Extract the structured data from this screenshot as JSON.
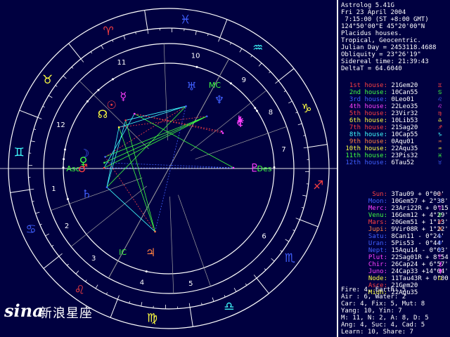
{
  "header": {
    "program": "Astrolog 5.41G",
    "date": "Fri 23 April 2004",
    "time": " 7:15:00 (ST +8:00 GMT)",
    "location": "124°50'00\"E 45°20'00\"N",
    "house_system": "Placidus houses.",
    "zodiac": "Tropical, Geocentric.",
    "julian_day": "Julian Day = 2453118.4688",
    "obliquity": "Obliquity = 23°26'19\"",
    "sidereal": "Sidereal time: 21:39:43",
    "delta_t": "DeltaT = 64.6040"
  },
  "houses": [
    {
      "label": "1st house:",
      "value": "21Gem20",
      "color": "#ff4040",
      "glyph": "♊"
    },
    {
      "label": "2nd house:",
      "value": "10Can55",
      "color": "#40ff40",
      "glyph": "♋"
    },
    {
      "label": "3rd house:",
      "value": "0Leo01",
      "color": "#4060ff",
      "glyph": "♌"
    },
    {
      "label": "4th house:",
      "value": "22Leo35",
      "color": "#ff40ff",
      "glyph": "♌"
    },
    {
      "label": "5th house:",
      "value": "23Vir32",
      "color": "#ff4040",
      "glyph": "♍"
    },
    {
      "label": "6th house:",
      "value": "10Lib53",
      "color": "#ffff40",
      "glyph": "♎"
    },
    {
      "label": "7th house:",
      "value": "21Sag20",
      "color": "#ff4040",
      "glyph": "♐"
    },
    {
      "label": "8th house:",
      "value": "10Cap55",
      "color": "#40ffff",
      "glyph": "♑"
    },
    {
      "label": "9th house:",
      "value": "0Aqu01",
      "color": "#ff8040",
      "glyph": "♒"
    },
    {
      "label": "10th house:",
      "value": "22Aqu35",
      "color": "#ffff40",
      "glyph": "♒"
    },
    {
      "label": "11th house:",
      "value": "23Pis32",
      "color": "#40ff40",
      "glyph": "♓"
    },
    {
      "label": "12th house:",
      "value": "6Tau52",
      "color": "#4060ff",
      "glyph": "♉"
    }
  ],
  "planets": [
    {
      "label": "Sun:",
      "value": "3Tau09 + 0°00'",
      "color": "#ff4040",
      "glyph": "☉"
    },
    {
      "label": "Moon:",
      "value": "10Gem57 + 2°38'",
      "color": "#4060ff",
      "glyph": "☽"
    },
    {
      "label": "Merc:",
      "value": "23Ari22R + 0°15'",
      "color": "#ff40ff",
      "glyph": "☿"
    },
    {
      "label": "Venu:",
      "value": "16Gem12 + 4°29'",
      "color": "#40ff40",
      "glyph": "♀"
    },
    {
      "label": "Mars:",
      "value": "20Gem51 + 1°13'",
      "color": "#ff4040",
      "glyph": "♂"
    },
    {
      "label": "Jupi:",
      "value": "9Vir08R + 1°22'",
      "color": "#ff8040",
      "glyph": "♃"
    },
    {
      "label": "Satu:",
      "value": "8Can11 - 0°24'",
      "color": "#4060ff",
      "glyph": "♄"
    },
    {
      "label": "Uran:",
      "value": "5Pis53 - 0°44'",
      "color": "#4060ff",
      "glyph": "♅"
    },
    {
      "label": "Nept:",
      "value": "15Aqu14 - 0°03'",
      "color": "#4060ff",
      "glyph": "♆"
    },
    {
      "label": "Plut:",
      "value": "22Sag01R + 8°54'",
      "color": "#ff40ff",
      "glyph": "♇"
    },
    {
      "label": "Chir:",
      "value": "26Cap24 + 6°57'",
      "color": "#ff40ff",
      "glyph": "⚷"
    },
    {
      "label": "Juno:",
      "value": "24Cap33 +14°04'",
      "color": "#ff40ff",
      "glyph": "⚵"
    },
    {
      "label": "Node:",
      "value": "11Tau43R + 0°00'",
      "color": "#ffff40",
      "glyph": "☊"
    },
    {
      "label": "Asce:",
      "value": "21Gem20",
      "color": "#ff4040",
      "glyph": ""
    },
    {
      "label": "Midh:",
      "value": "22Aqu35",
      "color": "#ffff40",
      "glyph": ""
    }
  ],
  "summary": [
    "Fire: 4, Earth: 5,",
    "Air : 6, Water: 2",
    "Car: 4, Fix: 5, Mut: 8",
    "Yang: 10, Yin: 7",
    "M: 11, N: 2, A: 8, D: 5",
    "Ang: 4, Suc: 4, Cad: 5",
    "Learn: 10, Share: 7"
  ],
  "wheel": {
    "sign_glyphs": [
      "♈",
      "♉",
      "♊",
      "♋",
      "♌",
      "♍",
      "♎",
      "♏",
      "♐",
      "♑",
      "♒",
      "♓"
    ],
    "sign_colors": [
      "#ff4040",
      "#ffff40",
      "#40ffff",
      "#4060ff",
      "#ff4040",
      "#ffff40",
      "#40ffff",
      "#4060ff",
      "#ff4040",
      "#ffff40",
      "#40ffff",
      "#4060ff"
    ],
    "house_numbers": [
      "1",
      "2",
      "3",
      "4",
      "5",
      "6",
      "7",
      "8",
      "9",
      "10",
      "11",
      "12"
    ],
    "angle_labels": {
      "asc": "Asc",
      "des": "Des",
      "mc": "MC",
      "ic": "IC"
    },
    "colors": {
      "ring": "#ffffff",
      "background": "#000040",
      "house_line": "#a0a0a0",
      "cross": "#ffffff"
    }
  },
  "watermark": {
    "s": "sina",
    "t": "新浪星座"
  }
}
